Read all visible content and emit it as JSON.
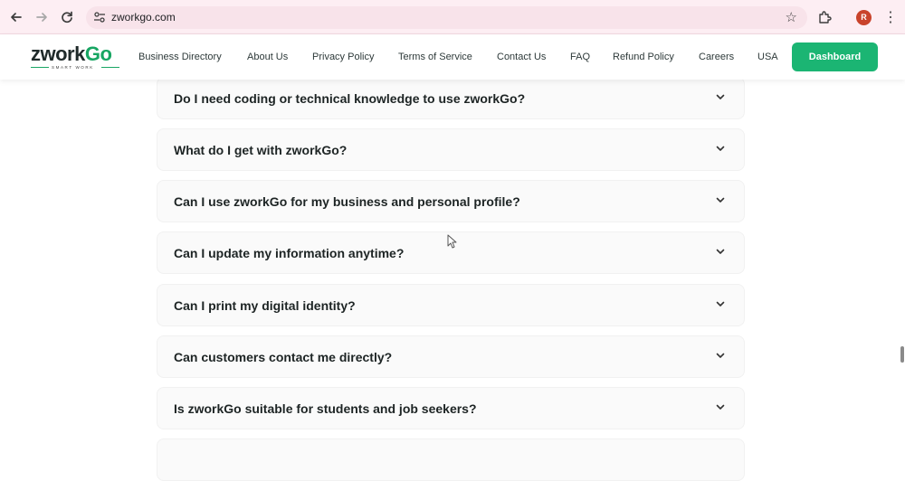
{
  "browser": {
    "url": "zworkgo.com",
    "avatar_letter": "R",
    "icons": {
      "back": "arrow-left-icon",
      "forward": "arrow-right-icon",
      "reload": "reload-icon",
      "site_settings": "tune-icon",
      "bookmark": "star-icon",
      "extensions": "puzzle-icon",
      "menu": "more-vertical-icon"
    }
  },
  "header": {
    "logo": {
      "prefix": "zwork",
      "accent": "Go",
      "tagline": "SMART WORK"
    },
    "nav": [
      "Business Directory",
      "About Us",
      "Privacy Policy",
      "Terms of Service",
      "Contact Us",
      "FAQ",
      "Refund Policy",
      "Careers",
      "USA"
    ],
    "dashboard_label": "Dashboard"
  },
  "faq": {
    "items": [
      "Do I need coding or technical knowledge to use zworkGo?",
      "What do I get with zworkGo?",
      "Can I use zworkGo for my business and personal profile?",
      "Can I update my information anytime?",
      "Can I print my digital identity?",
      "Can customers contact me directly?",
      "Is zworkGo suitable for students and job seekers?"
    ]
  },
  "colors": {
    "brand_green": "#1bb573",
    "chrome_bg": "#fdeef3",
    "text_dark": "#1d2424"
  }
}
